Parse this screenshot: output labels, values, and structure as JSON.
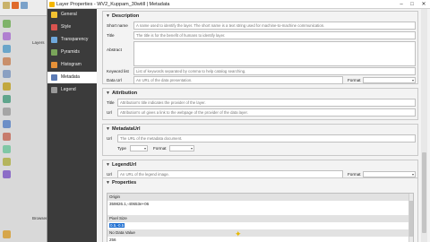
{
  "dialog": {
    "title": "Layer Properties - WV2_Kuppam_30wtill | Metadata",
    "minimize": "–",
    "maximize": "□",
    "close": "✕"
  },
  "background": {
    "layers_label": "Layers",
    "browser_label": "Browser"
  },
  "nav": {
    "items": [
      {
        "label": "General",
        "icon_color": "#f2c231"
      },
      {
        "label": "Style",
        "icon_color": "#d9534f"
      },
      {
        "label": "Transparency",
        "icon_color": "#6fa8dc"
      },
      {
        "label": "Pyramids",
        "icon_color": "#7aa55a"
      },
      {
        "label": "Histogram",
        "icon_color": "#e69138"
      },
      {
        "label": "Metadata",
        "icon_color": "#5b7bb5"
      },
      {
        "label": "Legend",
        "icon_color": "#999999"
      }
    ],
    "active_index": 5
  },
  "description": {
    "title": "Description",
    "short_name_label": "Short name",
    "short_name_placeholder": "A name used to identify the layer. The short name is a text string used for machine-to-machine communication.",
    "title_label": "Title",
    "title_placeholder": "The title is for the benefit of humans to identify layer.",
    "abstract_label": "Abstract",
    "keyword_label": "Keyword list",
    "keyword_placeholder": "List of keywords separated by comma to help catalog searching.",
    "dataurl_label": "Data Url",
    "dataurl_placeholder": "An URL of the data presentation.",
    "format_label": "Format"
  },
  "attribution": {
    "title": "Attribution",
    "title_label": "Title",
    "title_placeholder": "Attribution's title indicates the provider of the layer.",
    "url_label": "Url",
    "url_placeholder": "Attribution's url gives a link to the webpage of the provider of the data layer."
  },
  "metadataurl": {
    "title": "MetadataUrl",
    "url_label": "Url",
    "url_placeholder": "The URL of the metadata document.",
    "type_label": "Type",
    "format_label": "Format"
  },
  "legendurl": {
    "title": "LegendUrl",
    "url_label": "Url",
    "url_placeholder": "An URL of the legend image.",
    "format_label": "Format"
  },
  "properties": {
    "title": "Properties",
    "rows": [
      {
        "text": "Origin",
        "header": true
      },
      {
        "text": "359826.1,-40653e+06",
        "header": false
      },
      {
        "text": "",
        "header": false
      },
      {
        "text": "Pixel Size",
        "header": true
      },
      {
        "text": "0.5,-0.5",
        "header": false,
        "selected": true
      },
      {
        "text": "No Data Value",
        "header": true
      },
      {
        "text": "256",
        "header": false
      }
    ]
  }
}
